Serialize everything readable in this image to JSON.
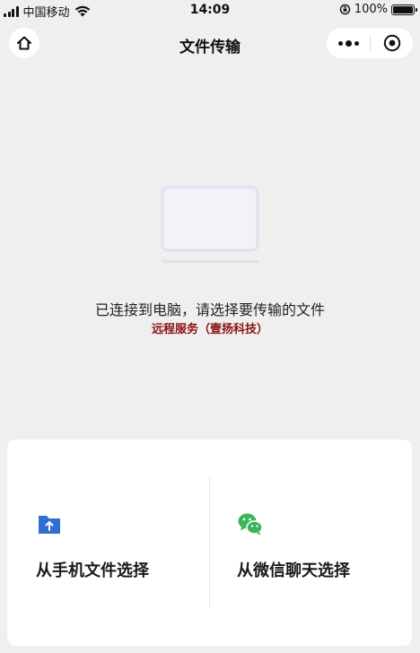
{
  "status_bar": {
    "carrier": "中国移动",
    "time": "14:09",
    "battery_text": "100%",
    "icons": [
      "signal-icon",
      "wifi-icon",
      "orientation-lock-icon",
      "battery-icon"
    ]
  },
  "nav": {
    "title": "文件传输",
    "home_icon": "home-icon",
    "more_icon": "more-icon",
    "close_icon": "close-miniprogram-icon"
  },
  "main": {
    "illustration_icon": "laptop-icon",
    "connected_text": "已连接到电脑，请选择要传输的文件",
    "service_text": "远程服务（壹扬科技）"
  },
  "options": {
    "phone_files_label": "从手机文件选择",
    "wechat_chat_label": "从微信聊天选择",
    "phone_icon": "folder-upload-icon",
    "wechat_icon": "wechat-icon"
  },
  "colors": {
    "background": "#efefef",
    "accent_blue": "#2f6fd1",
    "wechat_green": "#3cb55a",
    "service_red": "#8a1010"
  }
}
